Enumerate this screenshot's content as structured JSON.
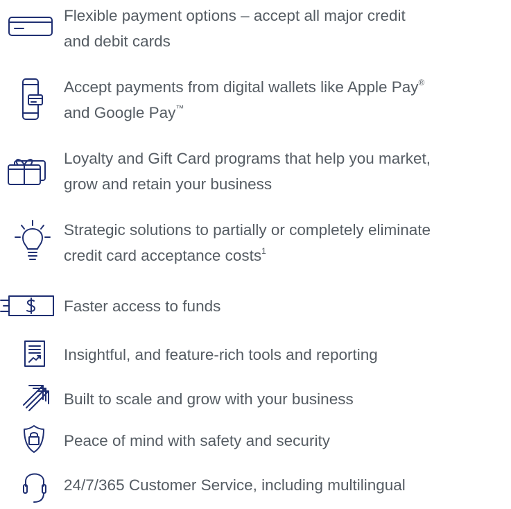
{
  "colors": {
    "icon": "#1f2f72",
    "text": "#555c63",
    "background": "#ffffff"
  },
  "features": [
    {
      "icon": "credit-card-icon",
      "lines": [
        "Flexible payment options – accept all major credit",
        "and debit cards"
      ]
    },
    {
      "icon": "mobile-wallet-icon",
      "lines": [
        "Accept payments from digital wallets like Apple Pay",
        "and Google Pay"
      ],
      "marks": [
        "®",
        "™"
      ]
    },
    {
      "icon": "gift-card-icon",
      "lines": [
        "Loyalty and Gift Card programs that help you market,",
        "grow and retain your business"
      ]
    },
    {
      "icon": "lightbulb-icon",
      "lines": [
        "Strategic solutions to partially or completely eliminate",
        "credit card acceptance costs"
      ],
      "footnote": "1"
    },
    {
      "icon": "dollar-bill-icon",
      "lines": [
        "Faster access to funds"
      ]
    },
    {
      "icon": "report-icon",
      "lines": [
        "Insightful, and feature-rich tools and reporting"
      ]
    },
    {
      "icon": "scale-growth-icon",
      "lines": [
        "Built to scale and grow with your business"
      ]
    },
    {
      "icon": "security-shield-icon",
      "lines": [
        "Peace of mind with safety and security"
      ]
    },
    {
      "icon": "headset-icon",
      "lines": [
        "24/7/365 Customer Service, including multilingual"
      ]
    }
  ]
}
